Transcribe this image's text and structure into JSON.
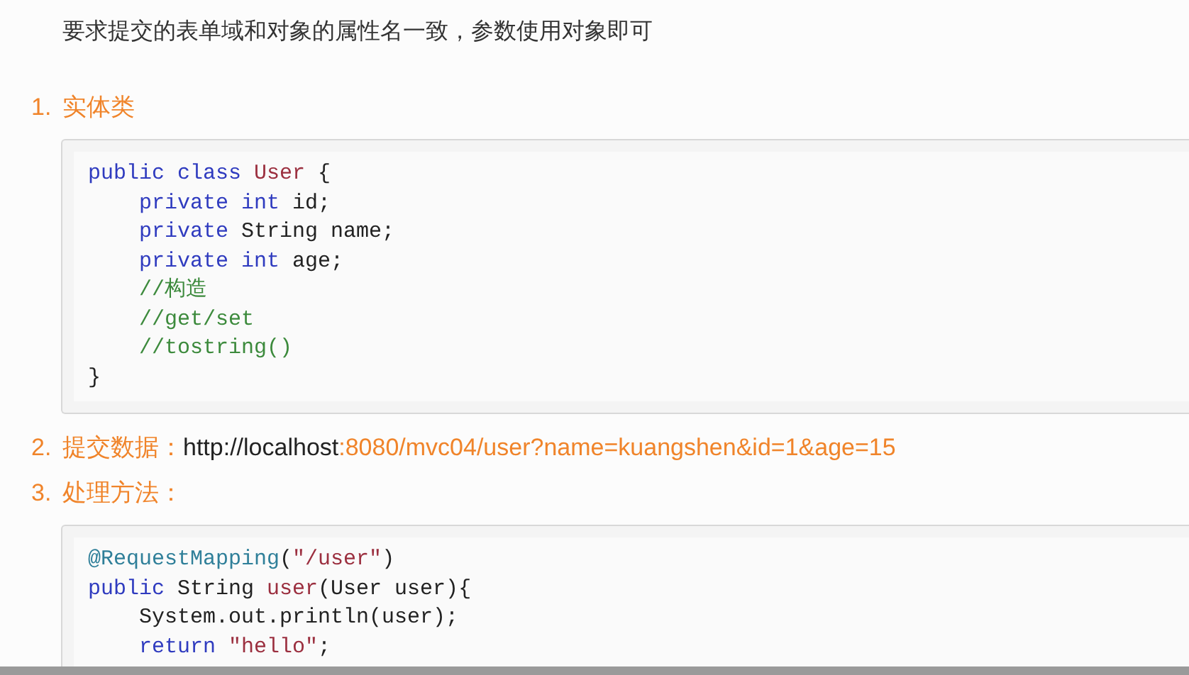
{
  "intro": "要求提交的表单域和对象的属性名一致，参数使用对象即可",
  "sections": [
    {
      "number": "1.",
      "title": "实体类",
      "code": [
        [
          {
            "kind": "keyword",
            "text": "public class "
          },
          {
            "kind": "type",
            "text": "User"
          },
          {
            "kind": "plain",
            "text": " {"
          }
        ],
        [
          {
            "kind": "keyword",
            "text": "    private int"
          },
          {
            "kind": "plain",
            "text": " id;"
          }
        ],
        [
          {
            "kind": "keyword",
            "text": "    private"
          },
          {
            "kind": "plain",
            "text": " String name;"
          }
        ],
        [
          {
            "kind": "keyword",
            "text": "    private int"
          },
          {
            "kind": "plain",
            "text": " age;"
          }
        ],
        [
          {
            "kind": "comment",
            "text": "    //构造"
          }
        ],
        [
          {
            "kind": "comment",
            "text": "    //get/set"
          }
        ],
        [
          {
            "kind": "comment",
            "text": "    //tostring()"
          }
        ],
        [
          {
            "kind": "plain",
            "text": "}"
          }
        ]
      ]
    },
    {
      "number": "2.",
      "title": "提交数据：",
      "url": [
        {
          "kind": "plain",
          "text": "http://localhost"
        },
        {
          "kind": "accent",
          "text": ":8080/mvc04/user?name=kuangshen&id=1&age=15"
        }
      ]
    },
    {
      "number": "3.",
      "title": "处理方法：",
      "code": [
        [
          {
            "kind": "annotation",
            "text": "@RequestMapping"
          },
          {
            "kind": "plain",
            "text": "("
          },
          {
            "kind": "string",
            "text": "\"/user\""
          },
          {
            "kind": "plain",
            "text": ")"
          }
        ],
        [
          {
            "kind": "keyword",
            "text": "public"
          },
          {
            "kind": "plain",
            "text": " String "
          },
          {
            "kind": "type",
            "text": "user"
          },
          {
            "kind": "plain",
            "text": "(User user){"
          }
        ],
        [
          {
            "kind": "plain",
            "text": "    System.out.println(user);"
          }
        ],
        [
          {
            "kind": "keyword",
            "text": "    return "
          },
          {
            "kind": "string",
            "text": "\"hello\""
          },
          {
            "kind": "plain",
            "text": ";"
          }
        ]
      ]
    }
  ]
}
